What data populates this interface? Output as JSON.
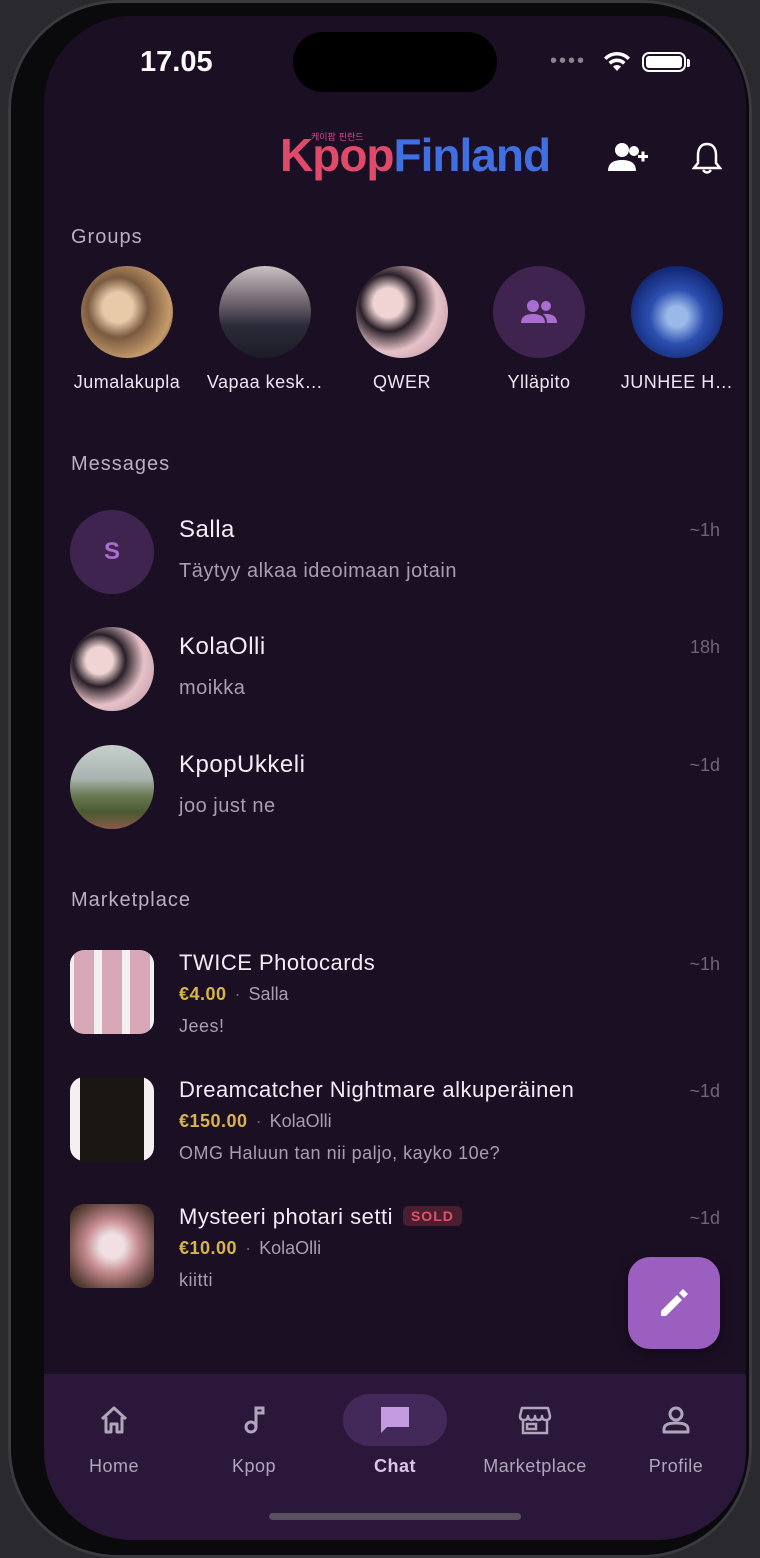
{
  "status_bar": {
    "time": "17.05"
  },
  "header": {
    "logo_kpop": "Kpop",
    "logo_finland": "Finland",
    "logo_korean": "케이팝 핀란드"
  },
  "groups": {
    "label": "Groups",
    "items": [
      {
        "name": "Jumalakupla"
      },
      {
        "name": "Vapaa kesk…"
      },
      {
        "name": "QWER"
      },
      {
        "name": "Ylläpito"
      },
      {
        "name": "JUNHEE H…"
      }
    ]
  },
  "messages": {
    "label": "Messages",
    "items": [
      {
        "initial": "S",
        "name": "Salla",
        "preview": "Täytyy alkaa ideoimaan jotain",
        "time": "~1h"
      },
      {
        "name": "KolaOlli",
        "preview": "moikka",
        "time": "18h"
      },
      {
        "name": "KpopUkkeli",
        "preview": "joo just ne",
        "time": "~1d"
      }
    ]
  },
  "marketplace": {
    "label": "Marketplace",
    "items": [
      {
        "title": "TWICE Photocards",
        "price": "€4.00",
        "seller": "Salla",
        "last": "Jees!",
        "time": "~1h"
      },
      {
        "title": "Dreamcatcher Nightmare alkuperäinen",
        "price": "€150.00",
        "seller": "KolaOlli",
        "last": "OMG Haluun tan nii paljo, kayko 10e?",
        "time": "~1d"
      },
      {
        "title": "Mysteeri photari setti",
        "badge": "SOLD",
        "price": "€10.00",
        "seller": "KolaOlli",
        "last": "kiitti",
        "time": "~1d"
      }
    ]
  },
  "tabs": [
    {
      "label": "Home",
      "icon": "home-icon"
    },
    {
      "label": "Kpop",
      "icon": "music-note-icon"
    },
    {
      "label": "Chat",
      "icon": "chat-icon",
      "active": true
    },
    {
      "label": "Marketplace",
      "icon": "store-icon"
    },
    {
      "label": "Profile",
      "icon": "person-icon"
    }
  ],
  "colors": {
    "accent": "#9b5fc0",
    "background": "#1b0f24",
    "price": "#d9b44a",
    "sold": "#e0526c"
  }
}
